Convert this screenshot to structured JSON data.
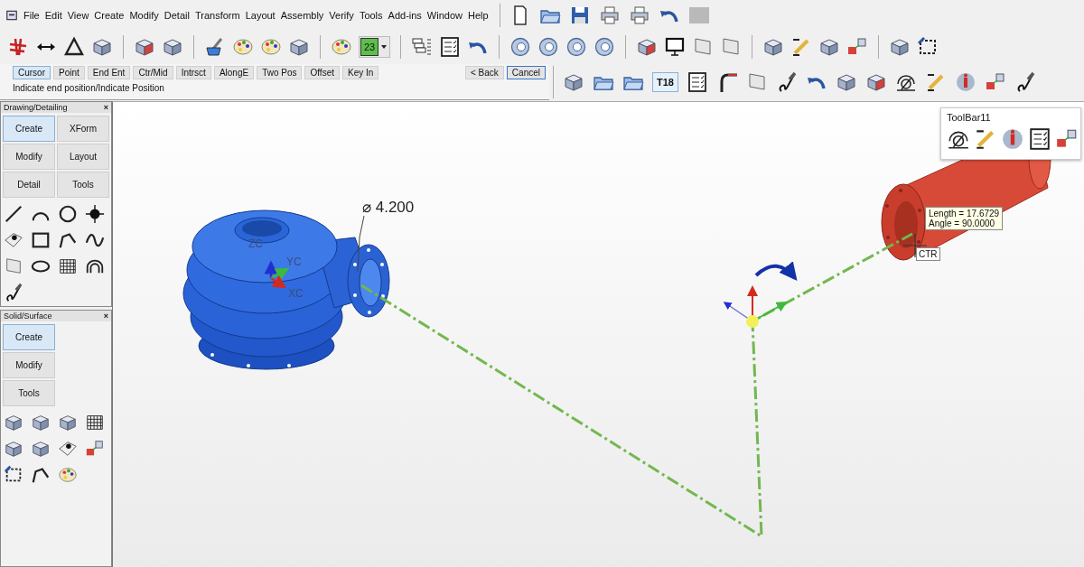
{
  "menu": [
    "File",
    "Edit",
    "View",
    "Create",
    "Modify",
    "Detail",
    "Transform",
    "Layout",
    "Assembly",
    "Verify",
    "Tools",
    "Add-ins",
    "Window",
    "Help"
  ],
  "toolbar_combo": {
    "value": "23"
  },
  "snap_bar": {
    "buttons": [
      {
        "label": "Cursor",
        "selected": true
      },
      {
        "label": "Point",
        "selected": false
      },
      {
        "label": "End Ent",
        "selected": false
      },
      {
        "label": "Ctr/Mid",
        "selected": false
      },
      {
        "label": "Intrsct",
        "selected": false
      },
      {
        "label": "AlongE",
        "selected": false
      },
      {
        "label": "Two Pos",
        "selected": false
      },
      {
        "label": "Offset",
        "selected": false
      },
      {
        "label": "Key In",
        "selected": false
      }
    ],
    "back": {
      "label": "< Back",
      "focused": false
    },
    "cancel": {
      "label": "Cancel",
      "focused": true
    }
  },
  "prompt": "Indicate end position/Indicate Position",
  "toolbar_button": {
    "label": "T18",
    "selected": true
  },
  "panels": [
    {
      "title": "Drawing/Detailing",
      "close": "×",
      "kind": "grid",
      "buttons": [
        {
          "label": "Create",
          "selected": true
        },
        {
          "label": "XForm",
          "selected": false
        },
        {
          "label": "Modify",
          "selected": false
        },
        {
          "label": "Layout",
          "selected": false
        },
        {
          "label": "Detail",
          "selected": false
        },
        {
          "label": "Tools",
          "selected": false
        }
      ]
    },
    {
      "title": "Solid/Surface",
      "close": "×",
      "kind": "list",
      "buttons": [
        {
          "label": "Create",
          "selected": true
        },
        {
          "label": "Modify",
          "selected": false
        },
        {
          "label": "Tools",
          "selected": false
        }
      ]
    }
  ],
  "canvas": {
    "dimension": "⌀ 4.200",
    "axis_labels": [
      "ZC",
      "YC",
      "XC"
    ],
    "tooltip": [
      "Length = 17.6729",
      "Angle = 90.0000"
    ],
    "snap_label": "CTR",
    "floating_toolbar": {
      "title": "ToolBar11"
    }
  }
}
